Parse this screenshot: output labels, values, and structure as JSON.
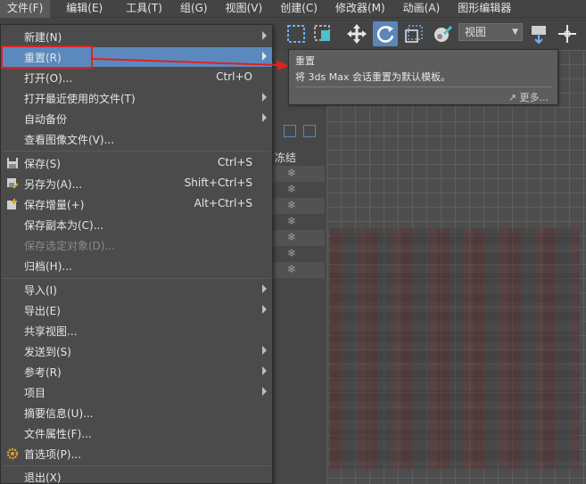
{
  "menubar": {
    "items": [
      {
        "label": "文件(F)"
      },
      {
        "label": "编辑(E)"
      },
      {
        "label": "工具(T)"
      },
      {
        "label": "组(G)"
      },
      {
        "label": "视图(V)"
      },
      {
        "label": "创建(C)"
      },
      {
        "label": "修改器(M)"
      },
      {
        "label": "动画(A)"
      },
      {
        "label": "图形编辑器"
      }
    ]
  },
  "toolbar": {
    "view_select": "视图",
    "icons": [
      "select-region-icon",
      "window-crossing-icon",
      "move-icon",
      "rotate-icon",
      "scale-icon",
      "place-icon",
      "pivot-icon",
      "snap-icon"
    ]
  },
  "file_menu": {
    "items": [
      {
        "label": "新建(N)",
        "shortcut": "",
        "submenu": true
      },
      {
        "label": "重置(R)",
        "shortcut": "",
        "submenu": true,
        "highlighted": true
      },
      {
        "label": "打开(O)...",
        "shortcut": "Ctrl+O",
        "submenu": false
      },
      {
        "label": "打开最近使用的文件(T)",
        "shortcut": "",
        "submenu": true
      },
      {
        "label": "自动备份",
        "shortcut": "",
        "submenu": true
      },
      {
        "label": "查看图像文件(V)...",
        "shortcut": "",
        "submenu": false
      },
      {
        "label": "保存(S)",
        "shortcut": "Ctrl+S",
        "submenu": false
      },
      {
        "label": "另存为(A)...",
        "shortcut": "Shift+Ctrl+S",
        "submenu": false
      },
      {
        "label": "保存增量(+)",
        "shortcut": "Alt+Ctrl+S",
        "submenu": false
      },
      {
        "label": "保存副本为(C)...",
        "shortcut": "",
        "submenu": false
      },
      {
        "label": "保存选定对象(D)...",
        "shortcut": "",
        "submenu": false,
        "disabled": true
      },
      {
        "label": "归档(H)...",
        "shortcut": "",
        "submenu": false
      },
      {
        "label": "导入(I)",
        "shortcut": "",
        "submenu": true
      },
      {
        "label": "导出(E)",
        "shortcut": "",
        "submenu": true
      },
      {
        "label": "共享视图...",
        "shortcut": "",
        "submenu": false
      },
      {
        "label": "发送到(S)",
        "shortcut": "",
        "submenu": true
      },
      {
        "label": "参考(R)",
        "shortcut": "",
        "submenu": true
      },
      {
        "label": "项目",
        "shortcut": "",
        "submenu": true
      },
      {
        "label": "摘要信息(U)...",
        "shortcut": "",
        "submenu": false
      },
      {
        "label": "文件属性(F)...",
        "shortcut": "",
        "submenu": false
      },
      {
        "label": "首选项(P)...",
        "shortcut": "",
        "submenu": false
      },
      {
        "label": "退出(X)",
        "shortcut": "",
        "submenu": false
      }
    ]
  },
  "tooltip": {
    "title": "重置",
    "description": "将 3ds Max 会话重置为默认模板。",
    "more": "更多..."
  },
  "scene_panel": {
    "column_header": "冻结"
  },
  "colors": {
    "highlight": "#5c89bd",
    "annotation_red": "#e02020",
    "menu_bg": "#4b4b4b"
  }
}
